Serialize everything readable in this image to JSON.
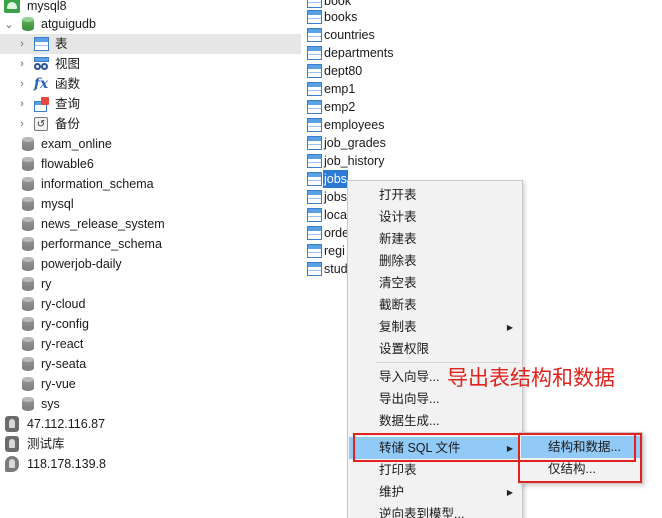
{
  "tree": {
    "items": [
      {
        "label": "mysql8",
        "icon": "mysql-connection-icon"
      },
      {
        "label": "atguigudb",
        "icon": "database-open-icon"
      },
      {
        "label": "表",
        "icon": "table-folder-icon"
      },
      {
        "label": "视图",
        "icon": "view-folder-icon"
      },
      {
        "label": "函数",
        "icon": "function-folder-icon"
      },
      {
        "label": "查询",
        "icon": "query-folder-icon"
      },
      {
        "label": "备份",
        "icon": "backup-folder-icon"
      },
      {
        "label": "exam_online",
        "icon": "database-icon"
      },
      {
        "label": "flowable6",
        "icon": "database-icon"
      },
      {
        "label": "information_schema",
        "icon": "database-icon"
      },
      {
        "label": "mysql",
        "icon": "database-icon"
      },
      {
        "label": "news_release_system",
        "icon": "database-icon"
      },
      {
        "label": "performance_schema",
        "icon": "database-icon"
      },
      {
        "label": "powerjob-daily",
        "icon": "database-icon"
      },
      {
        "label": "ry",
        "icon": "database-icon"
      },
      {
        "label": "ry-cloud",
        "icon": "database-icon"
      },
      {
        "label": "ry-config",
        "icon": "database-icon"
      },
      {
        "label": "ry-react",
        "icon": "database-icon"
      },
      {
        "label": "ry-seata",
        "icon": "database-icon"
      },
      {
        "label": "ry-vue",
        "icon": "database-icon"
      },
      {
        "label": "sys",
        "icon": "database-icon"
      },
      {
        "label": "47.112.116.87",
        "icon": "connection-icon"
      },
      {
        "label": "测试库",
        "icon": "connection-icon"
      },
      {
        "label": "118.178.139.8",
        "icon": "leaf-connection-icon"
      }
    ]
  },
  "tables": [
    {
      "name": "book"
    },
    {
      "name": "books"
    },
    {
      "name": "countries"
    },
    {
      "name": "departments"
    },
    {
      "name": "dept80"
    },
    {
      "name": "emp1"
    },
    {
      "name": "emp2"
    },
    {
      "name": "employees"
    },
    {
      "name": "job_grades"
    },
    {
      "name": "job_history"
    },
    {
      "name": "jobs"
    },
    {
      "name": "jobs"
    },
    {
      "name": "loca"
    },
    {
      "name": "orde"
    },
    {
      "name": "regi"
    },
    {
      "name": "stud"
    }
  ],
  "context_menu": {
    "items": [
      {
        "label": "打开表"
      },
      {
        "label": "设计表"
      },
      {
        "label": "新建表"
      },
      {
        "label": "删除表"
      },
      {
        "label": "清空表"
      },
      {
        "label": "截断表"
      },
      {
        "label": "复制表"
      },
      {
        "label": "设置权限"
      },
      {
        "label": "导入向导..."
      },
      {
        "label": "导出向导..."
      },
      {
        "label": "数据生成..."
      },
      {
        "label": "转储 SQL 文件"
      },
      {
        "label": "打印表"
      },
      {
        "label": "维护"
      },
      {
        "label": "逆向表到模型..."
      }
    ]
  },
  "submenu": {
    "items": [
      {
        "label": "结构和数据..."
      },
      {
        "label": "仅结构..."
      }
    ]
  },
  "annotation": "导出表结构和数据",
  "colors": {
    "selection": "#91c9f7",
    "highlight": "#2a7ad6",
    "annotation_red": "#e0231e"
  }
}
